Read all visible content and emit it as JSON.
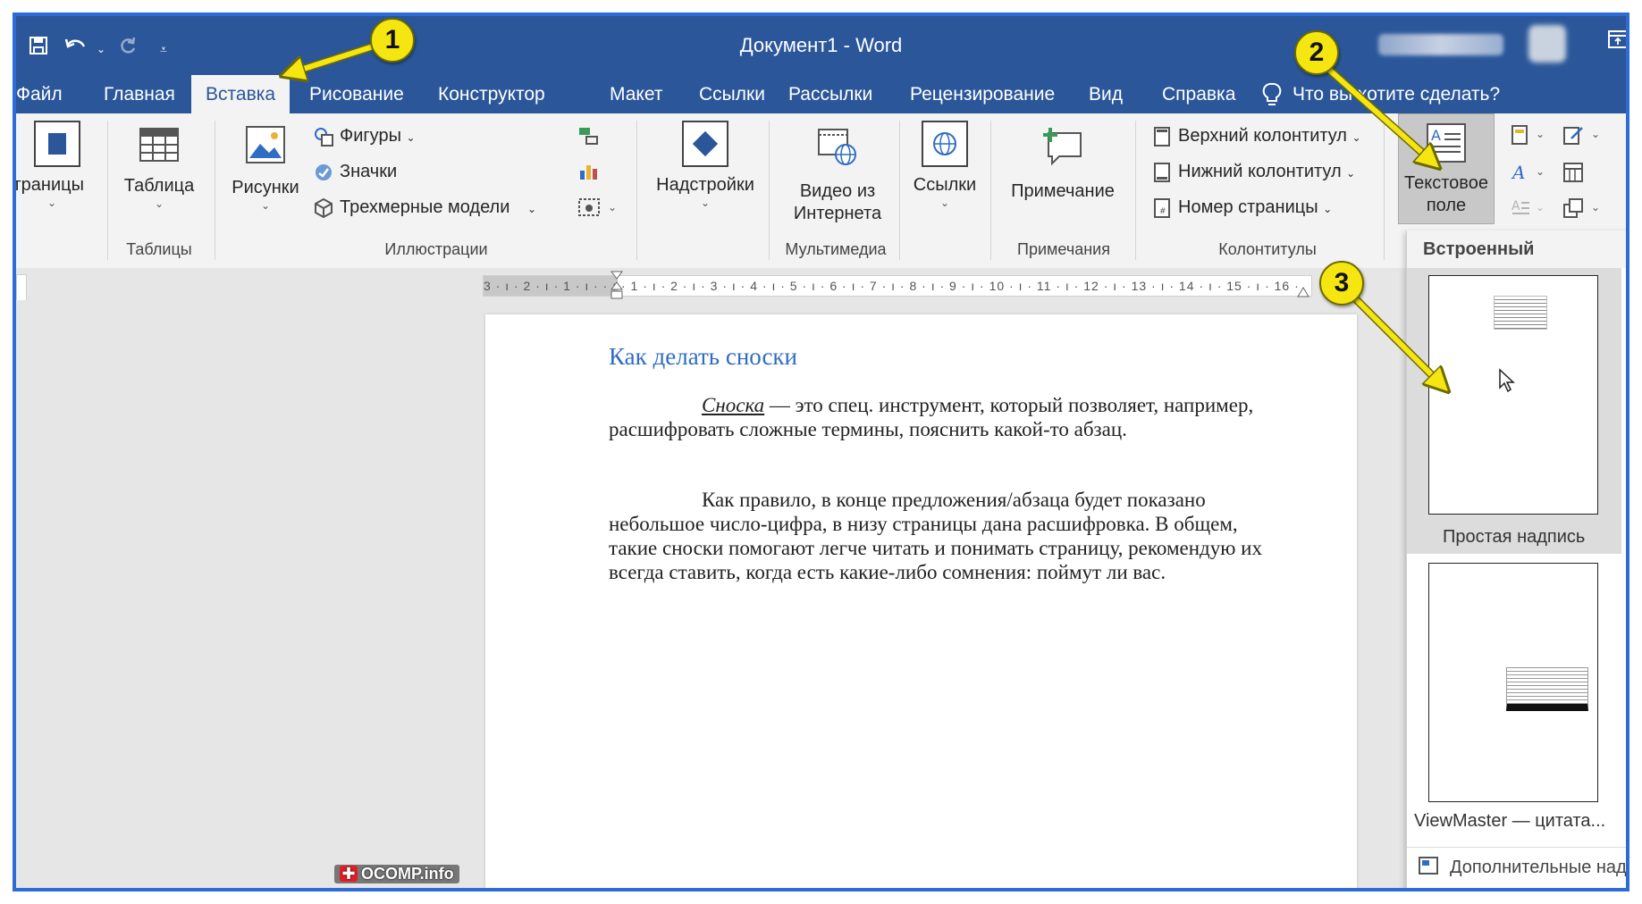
{
  "window": {
    "title": "Документ1  -  Word"
  },
  "qat": {
    "save_icon": "save-icon",
    "undo_icon": "undo-icon",
    "redo_icon": "redo-icon",
    "customize_icon": "customize-icon"
  },
  "tabs": [
    {
      "label": "Файл"
    },
    {
      "label": "Главная"
    },
    {
      "label": "Вставка"
    },
    {
      "label": "Рисование"
    },
    {
      "label": "Конструктор"
    },
    {
      "label": "Макет"
    },
    {
      "label": "Ссылки"
    },
    {
      "label": "Рассылки"
    },
    {
      "label": "Рецензирование"
    },
    {
      "label": "Вид"
    },
    {
      "label": "Справка"
    }
  ],
  "tellme": "Что вы хотите сделать?",
  "ribbon": {
    "pages": "Страницы",
    "table": "Таблица",
    "tables_group": "Таблицы",
    "pictures": "Рисунки",
    "shapes": "Фигуры",
    "icons": "Значки",
    "models3d": "Трехмерные модели",
    "illustrations_group": "Иллюстрации",
    "addins": "Надстройки",
    "online_video_1": "Видео из",
    "online_video_2": "Интернета",
    "media_group": "Мультимедиа",
    "links": "Ссылки",
    "comment": "Примечание",
    "comments_group": "Примечания",
    "header": "Верхний колонтитул",
    "footer": "Нижний колонтитул",
    "page_number": "Номер страницы",
    "headers_group": "Колонтитулы",
    "textbox_1": "Текстовое",
    "textbox_2": "поле"
  },
  "ruler": {
    "text": "3 · ı · 2 · ı · 1 · ı ·   · ı · 1 · ı · 2 · ı · 3 · ı · 4 · ı · 5 · ı · 6 · ı · 7 · ı · 8 · ı · 9 · ı · 10 · ı · 11 · ı · 12 · ı · 13 · ı · 14 · ı · 15 · ı · 16 ·"
  },
  "document": {
    "heading": "Как делать сноски",
    "p1_term": "Сноска",
    "p1_rest": " — это спец. инструмент, который позволяет, например, расшифровать сложные термины, пояснить какой-то абзац.",
    "p2": "Как правило, в конце предложения/абзаца будет показано небольшое число-цифра, в низу страницы дана расшифровка. В общем, такие сноски помогают легче читать и понимать страницу, рекомендую их всегда ставить, когда есть какие-либо сомнения: поймут ли вас."
  },
  "gallery": {
    "header": "Встроенный",
    "item1": "Простая надпись",
    "item2": "ViewMaster — цитата...",
    "more": "Дополнительные над"
  },
  "badges": [
    "1",
    "2",
    "3"
  ],
  "watermark": "OCOMP.info",
  "colors": {
    "ribbon_blue": "#2b579a",
    "arrow_yellow": "#f5e612",
    "heading_blue": "#2f6cc2"
  }
}
